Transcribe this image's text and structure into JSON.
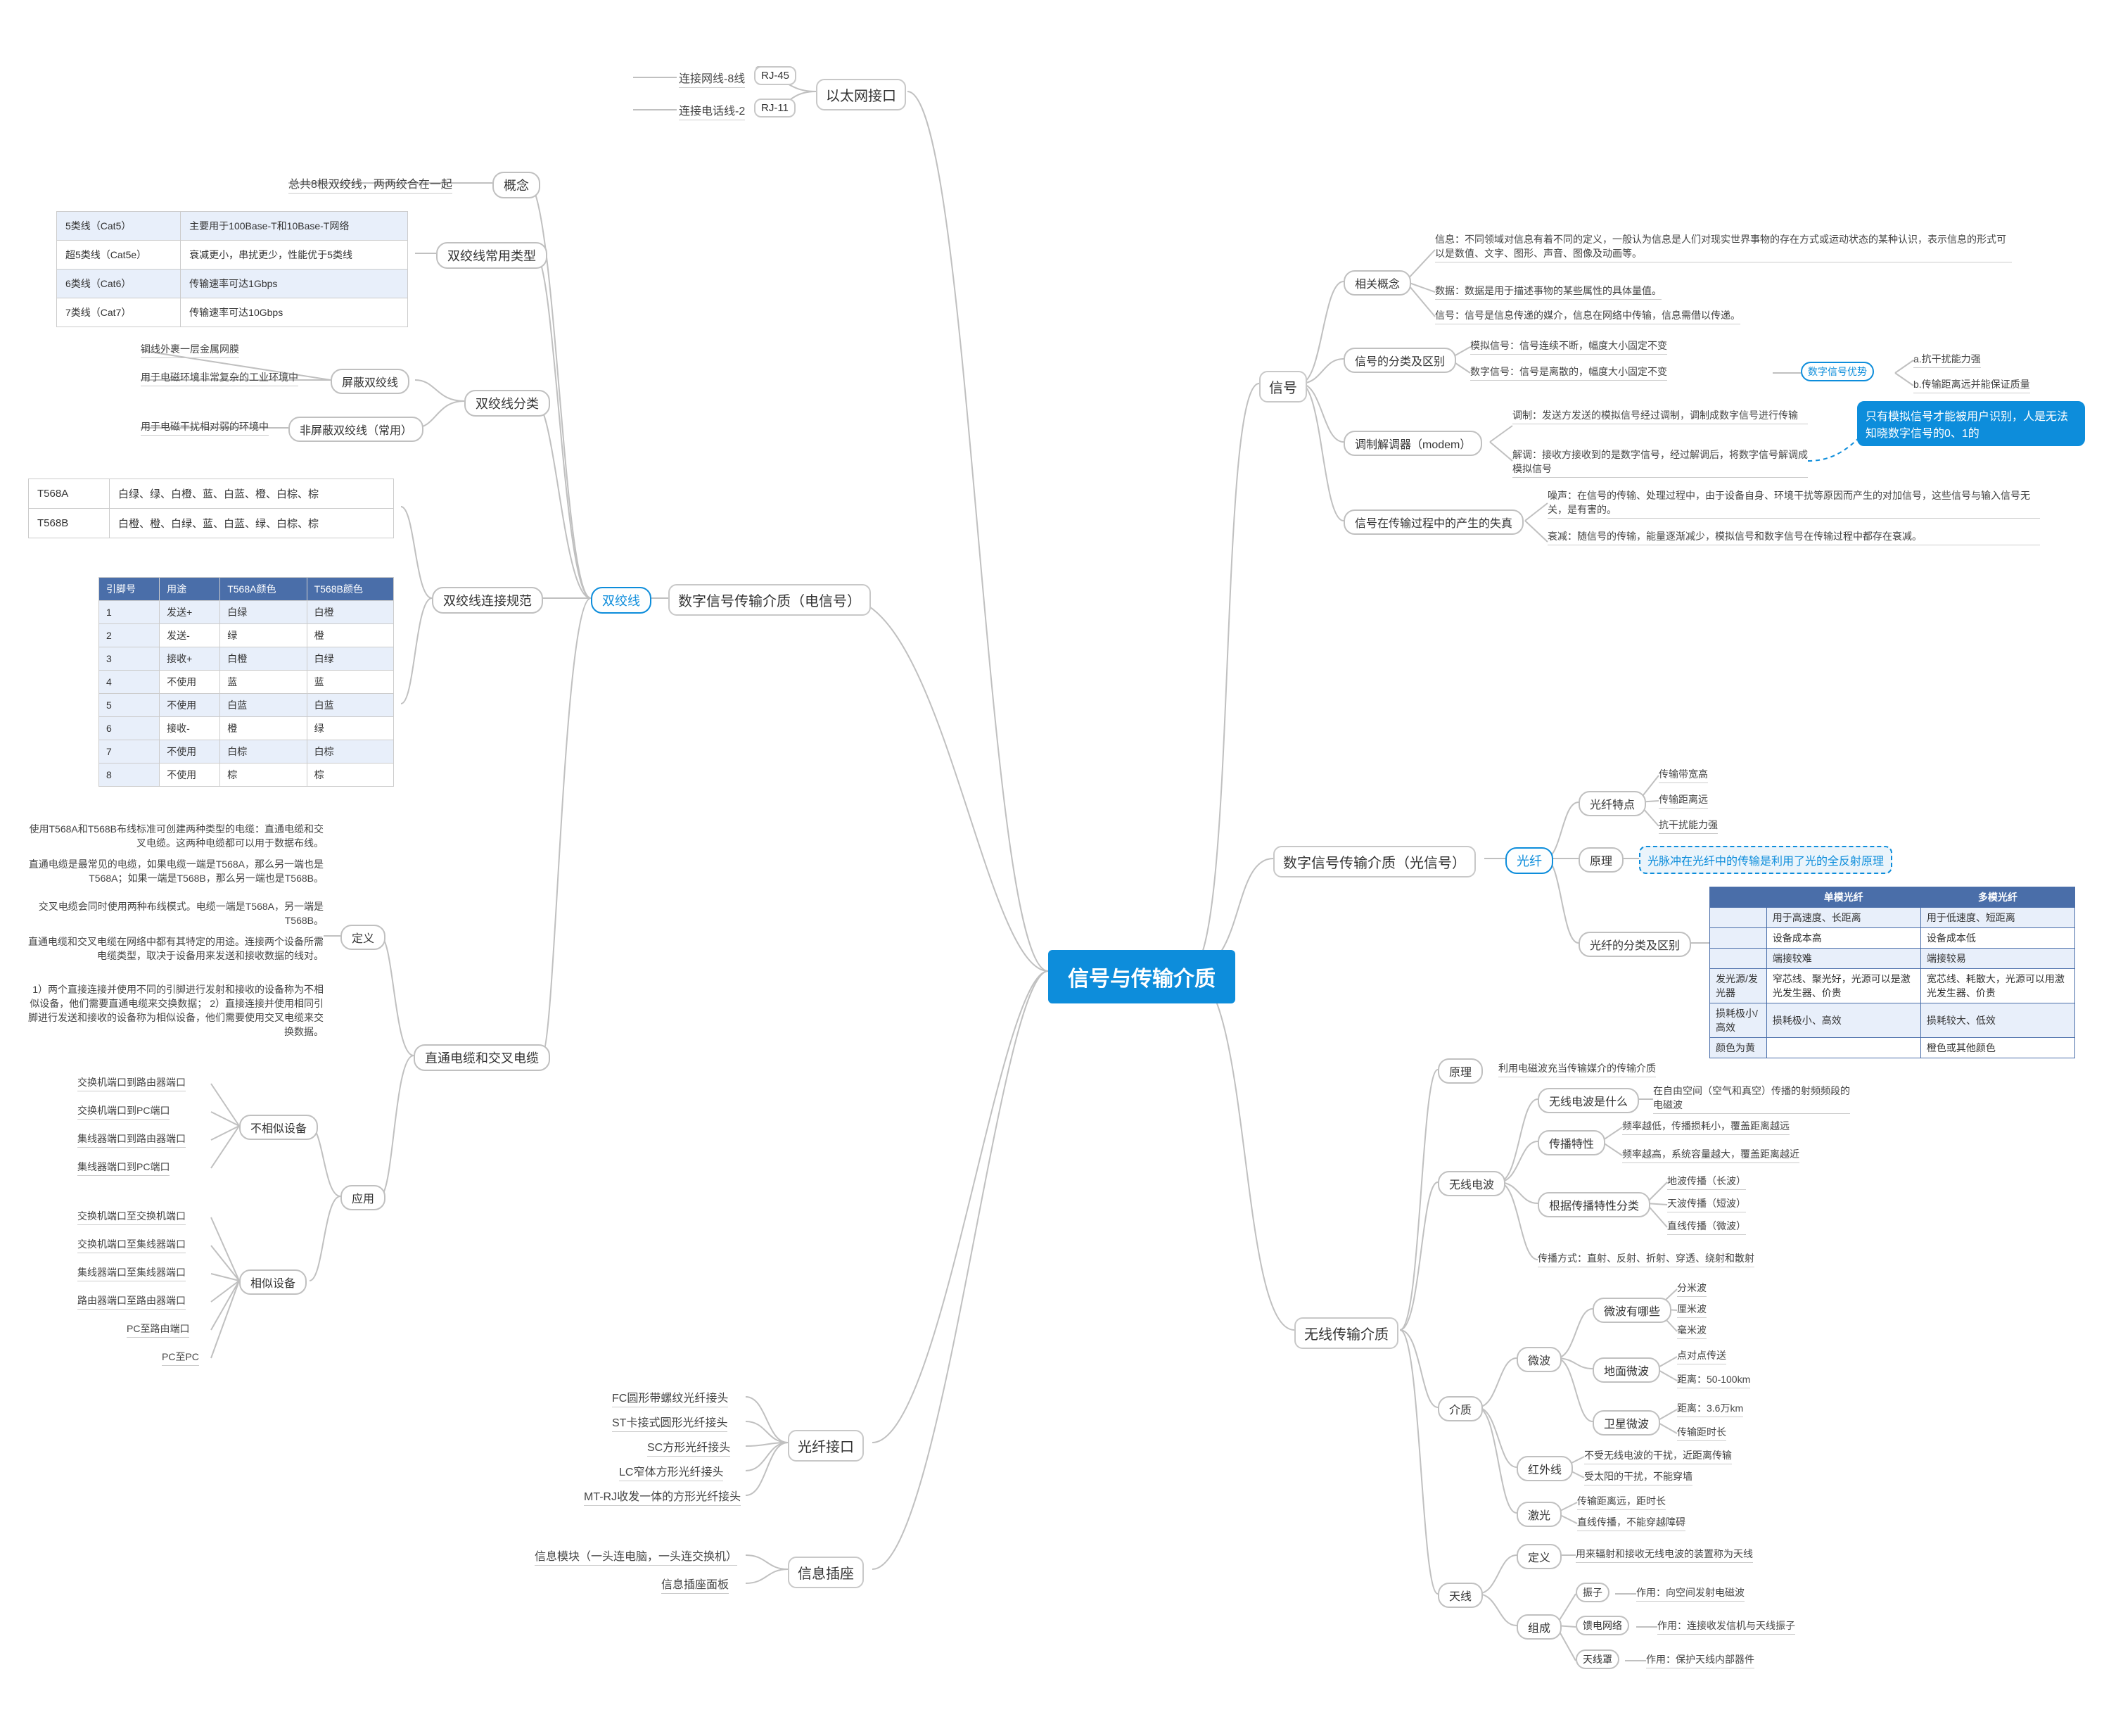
{
  "root": "信号与传输介质",
  "ethernet": {
    "title": "以太网接口",
    "items": [
      {
        "label": "连接网线-8线",
        "value": "RJ-45"
      },
      {
        "label": "连接电话线-2",
        "value": "RJ-11"
      }
    ]
  },
  "digital_electric": {
    "title": "数字信号传输介质（电信号）",
    "twisted_pair": "双绞线",
    "overview": {
      "label": "概念",
      "text": "总共8根双绞线，两两绞合在一起"
    },
    "common_types": {
      "label": "双绞线常用类型",
      "rows": [
        {
          "c1": "5类线（Cat5）",
          "c2": "主要用于100Base-T和10Base-T网络"
        },
        {
          "c1": "超5类线（Cat5e）",
          "c2": "衰减更小，串扰更少，性能优于5类线"
        },
        {
          "c1": "6类线（Cat6）",
          "c2": "传输速率可达1Gbps"
        },
        {
          "c1": "7类线（Cat7）",
          "c2": "传输速率可达10Gbps"
        }
      ]
    },
    "classification": {
      "label": "双绞线分类",
      "shielded": {
        "label": "屏蔽双绞线",
        "note1": "铜线外裹一层金属网膜",
        "note2": "用于电磁环境非常复杂的工业环境中"
      },
      "unshielded": {
        "label": "非屏蔽双绞线（常用）",
        "note": "用于电磁干扰相对弱的环境中"
      }
    },
    "wiring_spec": {
      "label": "双绞线连接规范",
      "standards": [
        {
          "name": "T568A",
          "order": "白绿、绿、白橙、蓝、白蓝、橙、白棕、棕"
        },
        {
          "name": "T568B",
          "order": "白橙、橙、白绿、蓝、白蓝、绿、白棕、棕"
        }
      ],
      "table": {
        "headers": [
          "引脚号",
          "用途",
          "T568A颜色",
          "T568B颜色"
        ],
        "rows": [
          [
            "1",
            "发送+",
            "白绿",
            "白橙"
          ],
          [
            "2",
            "发送-",
            "绿",
            "橙"
          ],
          [
            "3",
            "接收+",
            "白橙",
            "白绿"
          ],
          [
            "4",
            "不使用",
            "蓝",
            "蓝"
          ],
          [
            "5",
            "不使用",
            "白蓝",
            "白蓝"
          ],
          [
            "6",
            "接收-",
            "橙",
            "绿"
          ],
          [
            "7",
            "不使用",
            "白棕",
            "白棕"
          ],
          [
            "8",
            "不使用",
            "棕",
            "棕"
          ]
        ]
      }
    },
    "straight_cross": {
      "label": "直通电缆和交叉电缆",
      "definition": {
        "label": "定义",
        "lines": [
          "使用T568A和T568B布线标准可创建两种类型的电缆：直通电缆和交叉电缆。这两种电缆都可以用于数据布线。",
          "直通电缆是最常见的电缆，如果电缆一端是T568A，那么另一端也是T568A；如果一端是T568B，那么另一端也是T568B。",
          "交叉电缆会同时使用两种布线模式。电缆一端是T568A，另一端是T568B。",
          "直通电缆和交叉电缆在网络中都有其特定的用途。连接两个设备所需电缆类型，取决于设备用来发送和接收数据的线对。",
          "1）两个直接连接并使用不同的引脚进行发射和接收的设备称为不相似设备，他们需要直通电缆来交换数据；\n2）直接连接并使用相同引脚进行发送和接收的设备称为相似设备，他们需要使用交叉电缆来交换数据。"
        ]
      },
      "application": {
        "label": "应用",
        "diff": {
          "label": "不相似设备",
          "items": [
            "交换机端口到路由器端口",
            "交换机端口到PC端口",
            "集线器端口到路由器端口",
            "集线器端口到PC端口"
          ]
        },
        "same": {
          "label": "相似设备",
          "items": [
            "交换机端口至交换机端口",
            "交换机端口至集线器端口",
            "集线器端口至集线器端口",
            "路由器端口至路由器端口",
            "PC至路由端口",
            "PC至PC"
          ]
        }
      }
    }
  },
  "fiber_iface": {
    "title": "光纤接口",
    "items": [
      "FC圆形带螺纹光纤接头",
      "ST卡接式圆形光纤接头",
      "SC方形光纤接头",
      "LC窄体方形光纤接头",
      "MT-RJ收发一体的方形光纤接头"
    ]
  },
  "info_socket": {
    "title": "信息插座",
    "items": [
      "信息模块（一头连电脑，一头连交换机）",
      "信息插座面板"
    ]
  },
  "signal": {
    "title": "信号",
    "related": {
      "label": "相关概念",
      "items": [
        "信息：不同领域对信息有着不同的定义，一般认为信息是人们对现实世界事物的存在方式或运动状态的某种认识，表示信息的形式可以是数值、文字、图形、声音、图像及动画等。",
        "数据：数据是用于描述事物的某些属性的具体量值。",
        "信号：信号是信息传递的媒介，信息在网络中传输，信息需借以传递。"
      ]
    },
    "types": {
      "label": "信号的分类及区别",
      "analog": "模拟信号：信号连续不断，幅度大小固定不变",
      "digital": "数字信号：信号是离散的，幅度大小固定不变",
      "adv_label": "数字信号优势",
      "adv_a": "a.抗干扰能力强",
      "adv_b": "b.传输距离远并能保证质量",
      "red": "只有模拟信号才能被用户识别，人是无法知晓数字信号的0、1的"
    },
    "modem": {
      "label": "调制解调器（modem）",
      "modulate": "调制：发送方发送的模拟信号经过调制，调制成数字信号进行传输",
      "demod": "解调：接收方接收到的是数字信号，经过解调后，将数字信号解调成模拟信号"
    },
    "distortion": {
      "label": "信号在传输过程中的产生的失真",
      "noise": "噪声：在信号的传输、处理过程中，由于设备自身、环境干扰等原因而产生的对加信号，这些信号与输入信号无关，是有害的。",
      "attenuation": "衰减：随信号的传输，能量逐渐减少，模拟信号和数字信号在传输过程中都存在衰减。"
    }
  },
  "optical": {
    "title": "数字信号传输介质（光信号）",
    "fiber": "光纤",
    "features": {
      "label": "光纤特点",
      "items": [
        "传输带宽高",
        "传输距离远",
        "抗干扰能力强"
      ]
    },
    "principle": {
      "label": "原理",
      "text": "光脉冲在光纤中的传输是利用了光的全反射原理"
    },
    "compare": {
      "label": "光纤的分类及区别",
      "headers": [
        "",
        "单模光纤",
        "多模光纤"
      ],
      "rows": [
        [
          "",
          "用于高速度、长距离",
          "用于低速度、短距离"
        ],
        [
          "",
          "设备成本高",
          "设备成本低"
        ],
        [
          "",
          "端接较难",
          "端接较易"
        ],
        [
          "发光源/发光器",
          "窄芯线、聚光好，光源可以是激光发生器、价贵",
          "宽芯线、耗散大，光源可以用激光发生器、价贵"
        ],
        [
          "损耗极小/高效",
          "损耗极小、高效",
          "损耗较大、低效"
        ],
        [
          "颜色为黄",
          "",
          "橙色或其他颜色"
        ]
      ]
    }
  },
  "wireless": {
    "title": "无线传输介质",
    "principle": {
      "label": "原理",
      "text": "利用电磁波充当传输媒介的传输介质"
    },
    "radio": {
      "label": "无线电波",
      "what": {
        "label": "无线电波是什么",
        "text": "在自由空间（空气和真空）传播的射频频段的电磁波"
      },
      "prop": {
        "label": "传播特性",
        "a": "频率越低，传播损耗小，覆盖距离越远",
        "b": "频率越高，系统容量越大，覆盖距离越近"
      },
      "by_prop": {
        "label": "根据传播特性分类",
        "items": [
          "地波传播（长波）",
          "天波传播（短波）",
          "直线传播（微波）"
        ]
      },
      "mode": {
        "label": "传播方式：直射、反射、折射、穿透、绕射和散射"
      }
    },
    "medium": {
      "label": "介质",
      "microwave": {
        "label": "微波",
        "kinds": {
          "label": "微波有哪些",
          "items": [
            "分米波",
            "厘米波",
            "毫米波"
          ]
        },
        "ground": {
          "label": "地面微波",
          "items": [
            "点对点传送",
            "距离：50-100km"
          ]
        },
        "satellite": {
          "label": "卫星微波",
          "items": [
            "距离：3.6万km",
            "传输距时长"
          ]
        }
      },
      "infrared": {
        "label": "红外线",
        "items": [
          "不受无线电波的干扰，近距离传输",
          "受太阳的干扰，不能穿墙"
        ]
      },
      "laser": {
        "label": "激光",
        "items": [
          "传输距离远，距时长",
          "直线传播，不能穿越障碍"
        ]
      }
    },
    "antenna": {
      "label": "天线",
      "definition": {
        "label": "定义",
        "text": "用来辐射和接收无线电波的装置称为天线"
      },
      "composition": {
        "label": "组成",
        "oscillator": {
          "label": "振子",
          "text": "作用：向空间发射电磁波"
        },
        "feedline": {
          "label": "馈电网络",
          "text": "作用：连接收发信机与天线振子"
        },
        "radome": {
          "label": "天线罩",
          "text": "作用：保护天线内部器件"
        }
      }
    }
  }
}
